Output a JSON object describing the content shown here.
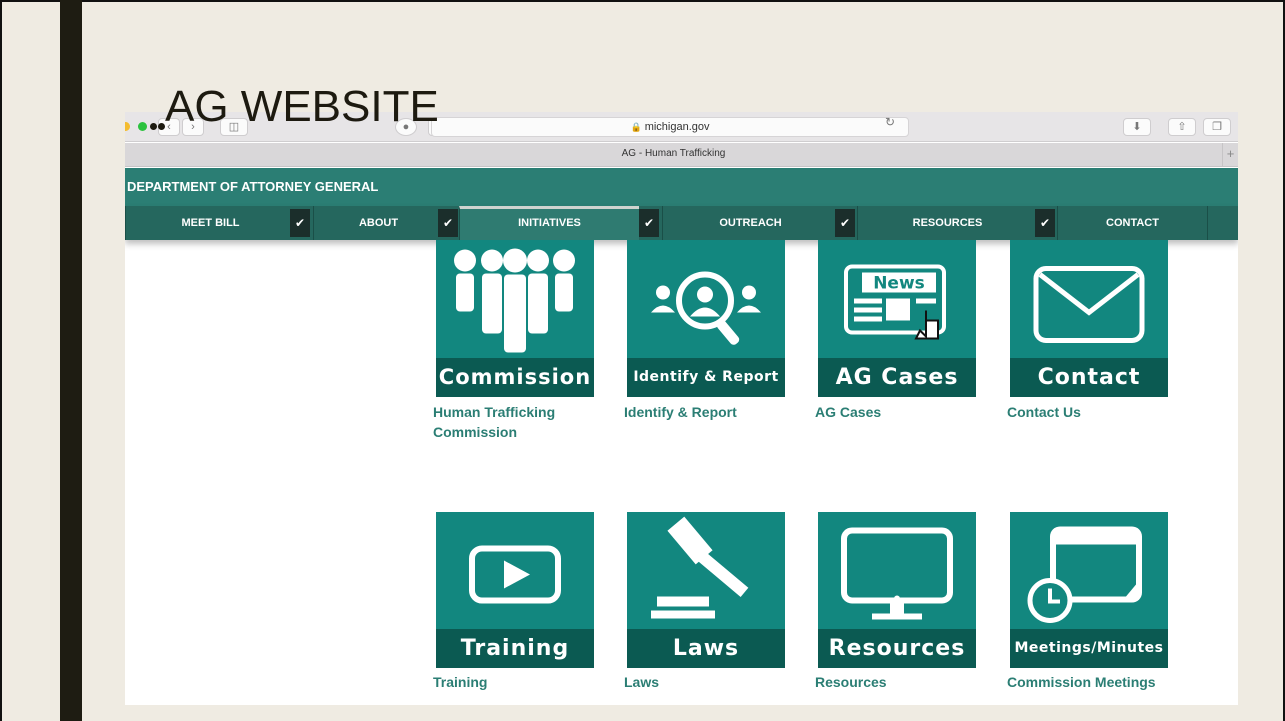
{
  "slide": {
    "title": "AG WEBSITE"
  },
  "browser": {
    "address": "michigan.gov",
    "tab_title": "AG - Human Trafficking",
    "tab_plus": "+"
  },
  "site": {
    "department": "DEPARTMENT OF ATTORNEY GENERAL",
    "nav": [
      {
        "label": "MEET BILL"
      },
      {
        "label": "ABOUT"
      },
      {
        "label": "INITIATIVES",
        "active": true
      },
      {
        "label": "OUTREACH"
      },
      {
        "label": "RESOURCES"
      },
      {
        "label": "CONTACT"
      }
    ],
    "tiles": [
      {
        "band": "Commission",
        "link": "Human Trafficking Commission",
        "icon": "people-icon"
      },
      {
        "band": "Identify & Report",
        "link": "Identify & Report",
        "icon": "magnifier-person-icon"
      },
      {
        "band": "AG Cases",
        "link": "AG Cases",
        "icon": "news-icon",
        "icon_text": "News"
      },
      {
        "band": "Contact",
        "link": "Contact Us",
        "icon": "envelope-icon"
      },
      {
        "band": "Training",
        "link": "Training",
        "icon": "play-icon"
      },
      {
        "band": "Laws",
        "link": "Laws",
        "icon": "gavel-icon"
      },
      {
        "band": "Resources",
        "link": "Resources",
        "icon": "monitor-icon"
      },
      {
        "band": "Meetings/Minutes",
        "link": "Commission Meetings",
        "icon": "calendar-clock-icon"
      }
    ]
  },
  "colors": {
    "tile": "#12877f",
    "tile_band": "#0b5a52",
    "header": "#2b7e74",
    "nav": "#25675e",
    "link": "#2b7e74"
  }
}
